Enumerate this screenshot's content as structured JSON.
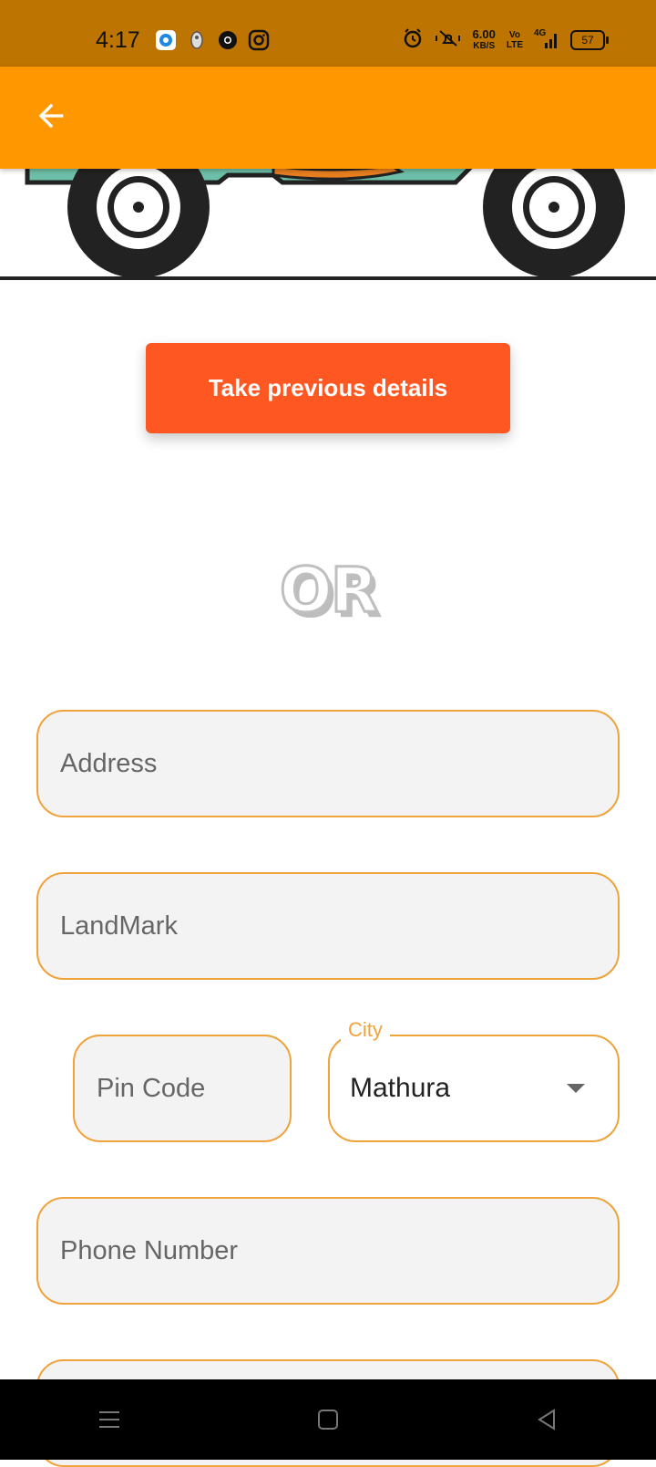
{
  "status_bar": {
    "time": "4:17",
    "net_speed_value": "6.00",
    "net_speed_unit": "KB/S",
    "volte_top": "Vo",
    "volte_bottom": "LTE",
    "network": "4G",
    "battery": "57"
  },
  "app_bar": {
    "back_icon": "arrow-back-icon"
  },
  "actions": {
    "previous_details_label": "Take previous details"
  },
  "divider_text": "OR",
  "form": {
    "address_placeholder": "Address",
    "landmark_placeholder": "LandMark",
    "pincode_placeholder": "Pin Code",
    "city_label": "City",
    "city_value": "Mathura",
    "phone_placeholder": "Phone Number"
  },
  "colors": {
    "status_bar": "#bd7400",
    "app_bar": "#ff9800",
    "primary_button": "#ff5722",
    "field_border": "#f0a23b"
  }
}
